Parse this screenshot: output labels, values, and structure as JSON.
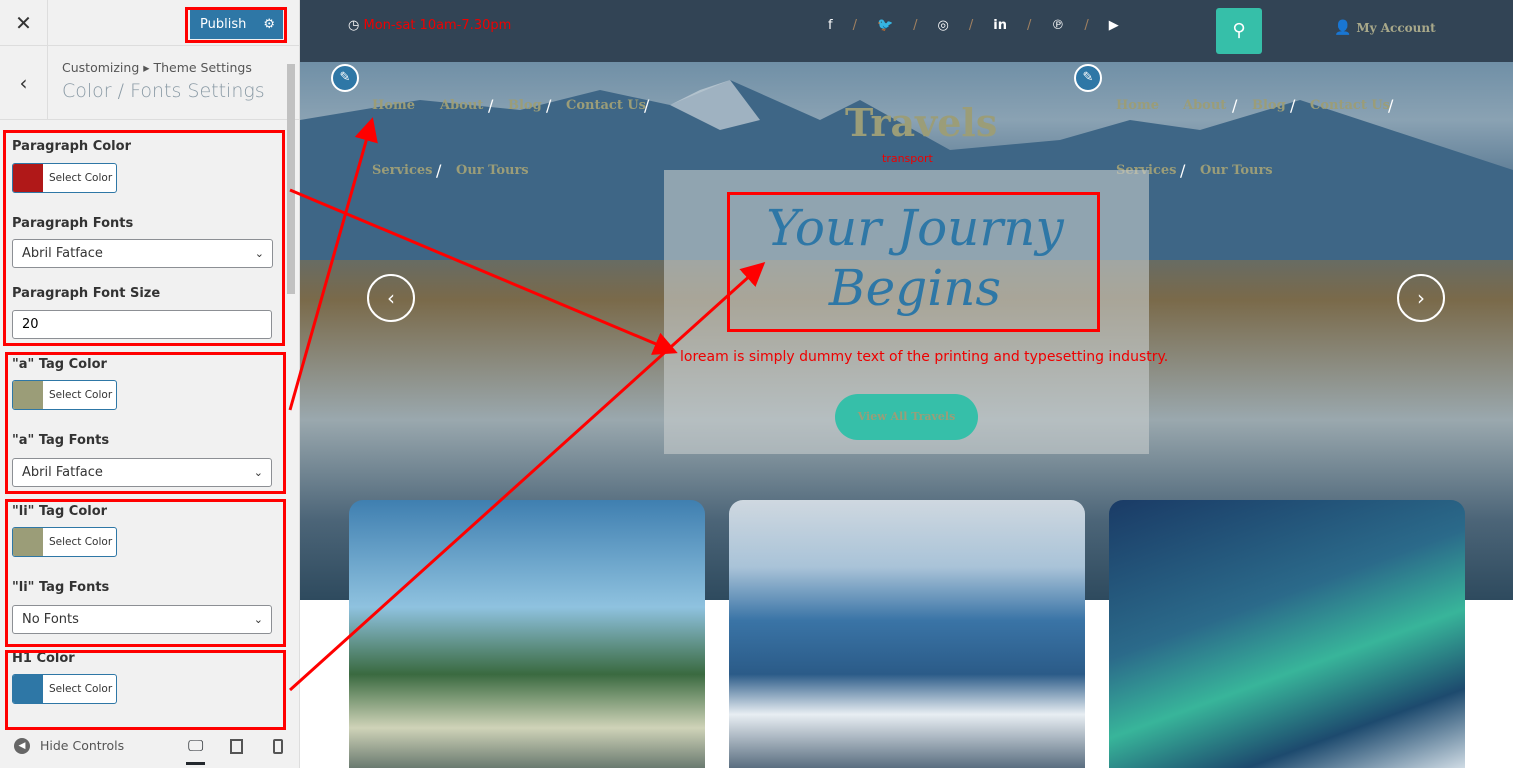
{
  "sidebar": {
    "close": "✕",
    "publish": "Publish",
    "back": "‹",
    "breadcrumb": "Customizing ▸ Theme Settings",
    "title": "Color / Fonts Settings",
    "controls": [
      {
        "label": "Paragraph Color",
        "type": "color",
        "color": "#cc1a1a",
        "button": "Select Color"
      },
      {
        "label": "Paragraph Fonts",
        "type": "select",
        "value": "Abril Fatface"
      },
      {
        "label": "Paragraph Font Size",
        "type": "input",
        "value": "20"
      },
      {
        "label": "\"a\" Tag Color",
        "type": "color",
        "color": "#9b9d78",
        "button": "Select Color"
      },
      {
        "label": "\"a\" Tag Fonts",
        "type": "select",
        "value": "Abril Fatface"
      },
      {
        "label": "\"li\" Tag Color",
        "type": "color",
        "color": "#9b9d78",
        "button": "Select Color"
      },
      {
        "label": "\"li\" Tag Fonts",
        "type": "select",
        "value": "No Fonts"
      },
      {
        "label": "H1 Color",
        "type": "color",
        "color": "#2e77a6",
        "button": "Select Color"
      }
    ],
    "hide_controls": "Hide Controls"
  },
  "site": {
    "hours": "Mon-sat 10am-7.30pm",
    "social": [
      "f",
      "t",
      "ig",
      "in",
      "p",
      "yt"
    ],
    "account": "My Account",
    "nav_left": [
      "Home",
      "About",
      "Blog",
      "Contact Us",
      "Services",
      "Our Tours"
    ],
    "nav_right": [
      "Home",
      "About",
      "Blog",
      "Contact Us",
      "Services",
      "Our Tours"
    ],
    "logo": "Travels",
    "tagline": "transport",
    "hero_title": "Your Journy Begins",
    "hero_text": "loream is simply dummy text of the printing and typesetting industry.",
    "cta": "View All Travels"
  },
  "colors": {
    "accent": "#36bfa9",
    "primary": "#2e77a6",
    "annotation": "#ff0000",
    "link": "#9b9d78",
    "paragraph": "#ee0000"
  }
}
